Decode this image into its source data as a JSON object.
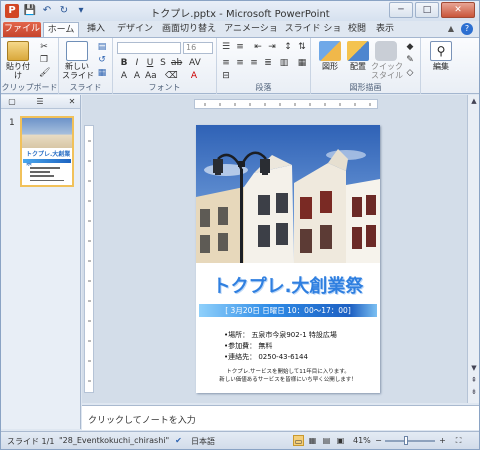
{
  "window": {
    "title": "トクプレ.pptx - Microsoft PowerPoint",
    "app_icon": "P",
    "controls": [
      "minimize",
      "maximize",
      "close"
    ]
  },
  "quick_access": {
    "items": [
      {
        "name": "save-icon",
        "glyph": "💾"
      },
      {
        "name": "undo-icon",
        "glyph": "↶"
      },
      {
        "name": "redo-icon",
        "glyph": "↻"
      },
      {
        "name": "customize-qat-icon",
        "glyph": "▾"
      }
    ]
  },
  "tabs": [
    {
      "label": "ファイル"
    },
    {
      "label": "ホーム"
    },
    {
      "label": "挿入"
    },
    {
      "label": "デザイン"
    },
    {
      "label": "画面切り替え"
    },
    {
      "label": "アニメーション"
    },
    {
      "label": "スライド ショー"
    },
    {
      "label": "校閲"
    },
    {
      "label": "表示"
    }
  ],
  "ribbon": {
    "groups": [
      {
        "label": "クリップボード",
        "big_button": "貼り付け"
      },
      {
        "label": "スライド",
        "big_button": "新しい\nスライド"
      },
      {
        "label": "フォント",
        "font_size": "16"
      },
      {
        "label": "段落"
      },
      {
        "label": "図形描画",
        "buttons": [
          "図形",
          "配置",
          "クイック\nスタイル"
        ]
      },
      {
        "label": "",
        "big_button": "編集"
      }
    ]
  },
  "slide_pane": {
    "slide_number": "1",
    "thumb_title": "トクプレ.大創業祭"
  },
  "slide": {
    "title": "トクプレ.大創業祭",
    "band": "[ 3月20日 日曜日  10：00～17：00]",
    "info": [
      "•場所：  五泉市今泉902-1 特設広場",
      "•参加費：  無料",
      "•連絡先：  0250-43-6144"
    ],
    "note_lines": [
      "トクプレ.サービスを開始して11年目に入ります。",
      "新しい価値あるサービスを皆様にいち早く公開します！"
    ]
  },
  "notes": {
    "placeholder": "クリックしてノートを入力"
  },
  "status": {
    "slide": "スライド 1/1",
    "theme": "\"28_Eventkokuchi_chirashi\"",
    "language": "日本語",
    "zoom": "41%",
    "zoom_fraction": 0.41
  }
}
